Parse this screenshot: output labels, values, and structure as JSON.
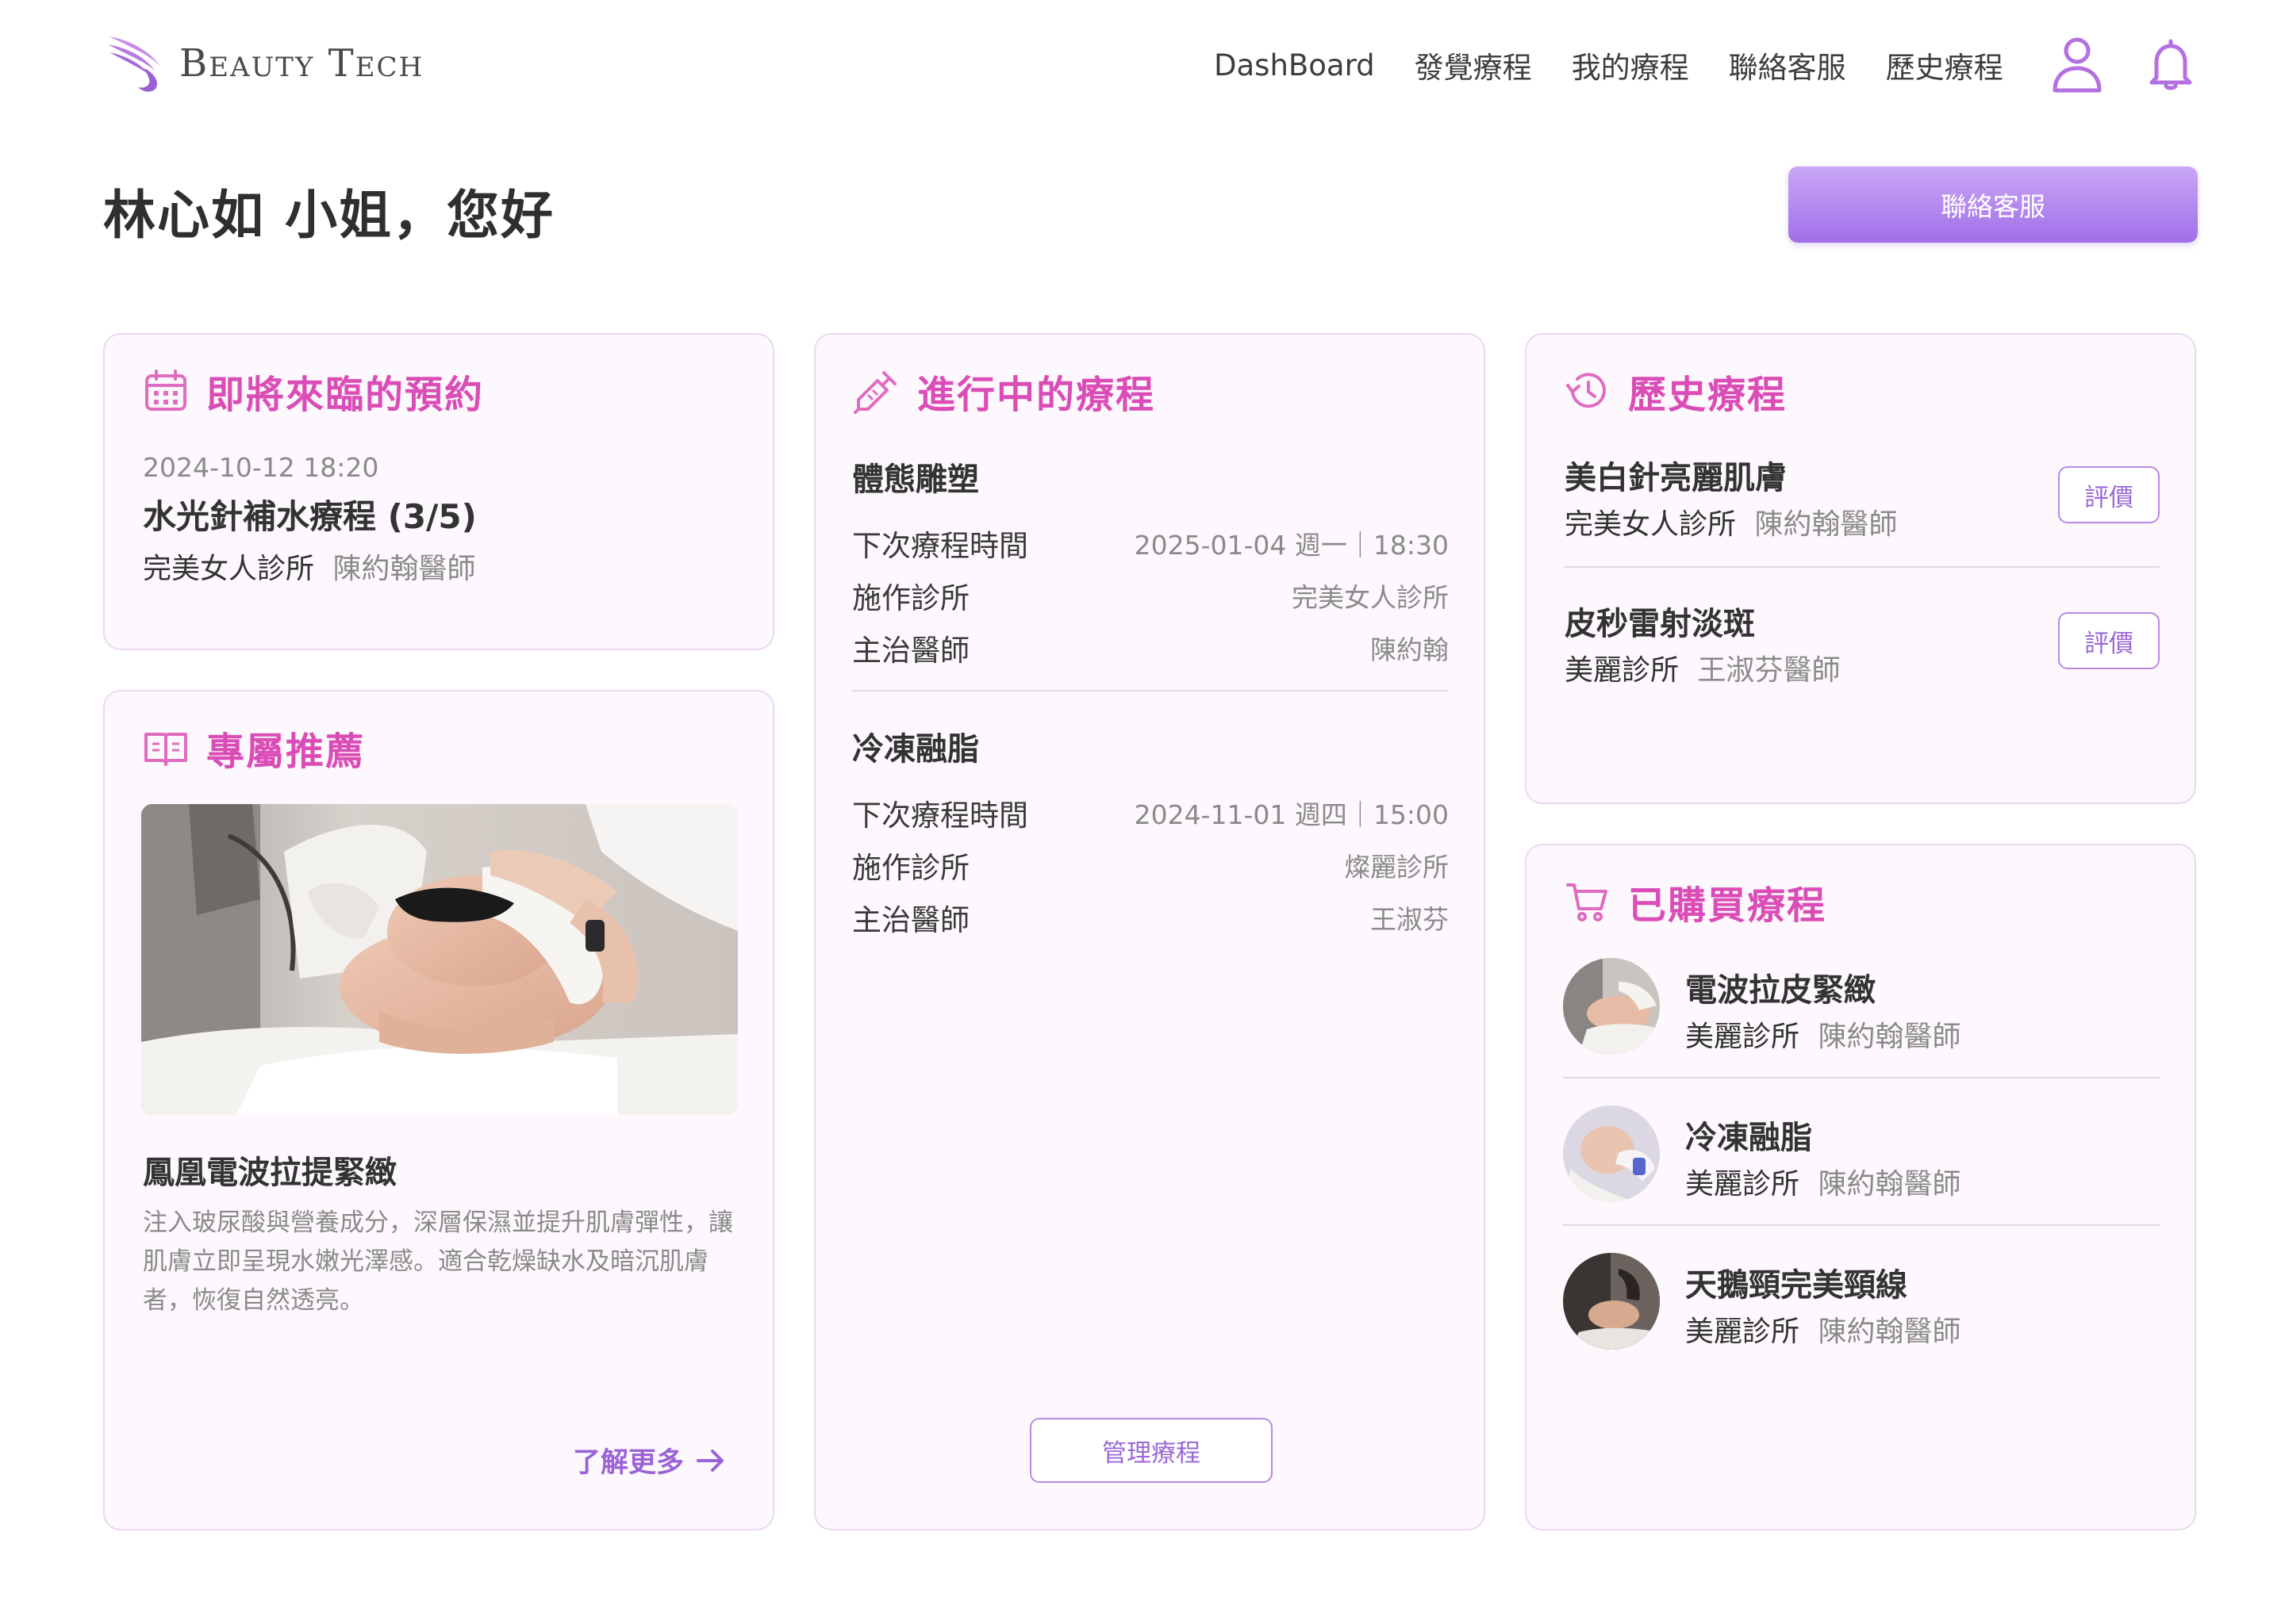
{
  "header": {
    "brand": "Beauty Tech",
    "nav": [
      "DashBoard",
      "發覺療程",
      "我的療程",
      "聯絡客服",
      "歷史療程"
    ]
  },
  "greeting": "林心如 小姐，您好",
  "contact_button": "聯絡客服",
  "upcoming": {
    "title": "即將來臨的預約",
    "datetime": "2024-10-12 18:20",
    "treatment": "水光針補水療程 (3/5)",
    "clinic": "完美女人診所",
    "doctor": "陳約翰醫師"
  },
  "recommend": {
    "title": "專屬推薦",
    "name": "鳳凰電波拉提緊緻",
    "description": "注入玻尿酸與營養成分，深層保濕並提升肌膚彈性，讓肌膚立即呈現水嫩光澤感。適合乾燥缺水及暗沉肌膚者，恢復自然透亮。",
    "more": "了解更多"
  },
  "ongoing": {
    "title": "進行中的療程",
    "items": [
      {
        "name": "體態雕塑",
        "next_label": "下次療程時間",
        "next_value": "2025-01-04 週一｜18:30",
        "clinic_label": "施作診所",
        "clinic_value": "完美女人診所",
        "doctor_label": "主治醫師",
        "doctor_value": "陳約翰"
      },
      {
        "name": "冷凍融脂",
        "next_label": "下次療程時間",
        "next_value": "2024-11-01 週四｜15:00",
        "clinic_label": "施作診所",
        "clinic_value": "燦麗診所",
        "doctor_label": "主治醫師",
        "doctor_value": "王淑芬"
      }
    ],
    "manage": "管理療程"
  },
  "history": {
    "title": "歷史療程",
    "items": [
      {
        "name": "美白針亮麗肌膚",
        "clinic": "完美女人診所",
        "doctor": "陳約翰醫師",
        "action": "評價"
      },
      {
        "name": "皮秒雷射淡斑",
        "clinic": "美麗診所",
        "doctor": "王淑芬醫師",
        "action": "評價"
      }
    ]
  },
  "purchased": {
    "title": "已購買療程",
    "items": [
      {
        "name": "電波拉皮緊緻",
        "clinic": "美麗診所",
        "doctor": "陳約翰醫師"
      },
      {
        "name": "冷凍融脂",
        "clinic": "美麗診所",
        "doctor": "陳約翰醫師"
      },
      {
        "name": "天鵝頸完美頸線",
        "clinic": "美麗診所",
        "doctor": "陳約翰醫師"
      }
    ]
  },
  "colors": {
    "accent": "#db4db6",
    "purple": "#a06fe8",
    "card_bg": "#fdf8fd",
    "card_border": "#e9d9ee"
  },
  "icons": [
    "wing-logo-icon",
    "user-icon",
    "bell-icon",
    "calendar-icon",
    "syringe-icon",
    "history-icon",
    "book-icon",
    "cart-icon",
    "arrow-right-icon"
  ]
}
